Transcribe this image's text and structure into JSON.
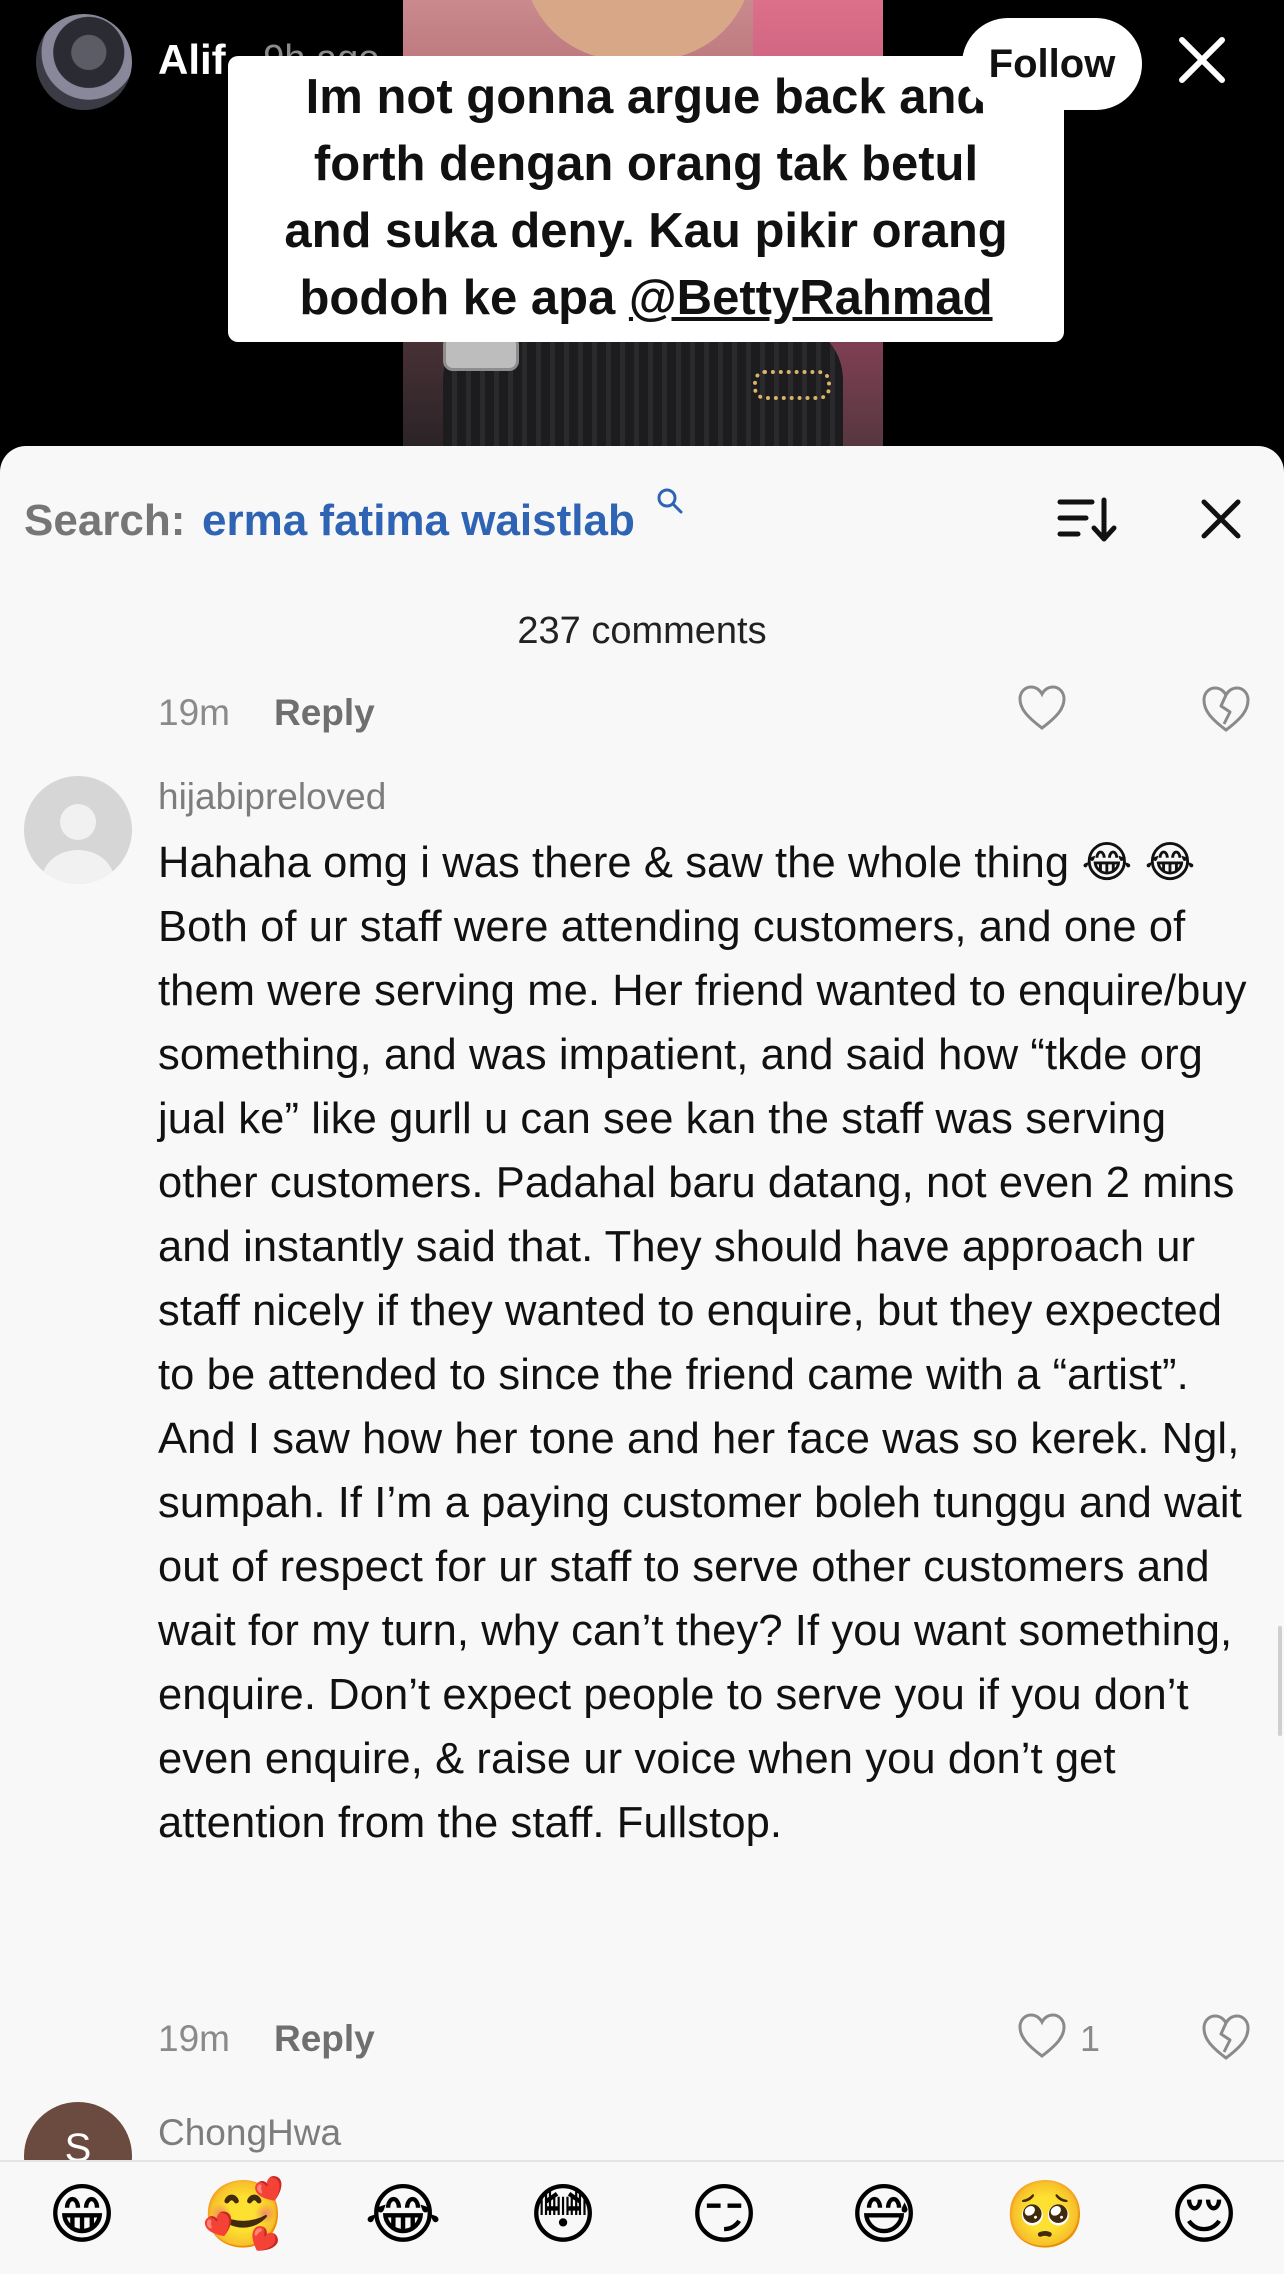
{
  "video": {
    "username": "Alif",
    "time_ago": "· 9h ago",
    "follow_label": "Follow",
    "caption_lines": [
      "Im not gonna argue back and",
      "forth dengan orang tak betul",
      "and suka deny. Kau pikir orang",
      "bodoh ke apa "
    ],
    "caption_mention": "@BettyRahmad"
  },
  "sheet": {
    "search_prefix": "Search:",
    "search_term": "erma fatima waistlab",
    "comment_count": "237 comments"
  },
  "previous_comment": {
    "time": "19m",
    "reply_label": "Reply"
  },
  "comment": {
    "username": "hijabipreloved",
    "text": "Hahaha omg i was there & saw the whole thing 😂 😂 Both of ur staff were attending customers, and one of them were serving me. Her friend wanted to enquire/buy something, and was impatient, and said how “tkde org jual ke” like gurll u can see kan the staff was serving other customers. Padahal baru datang, not even 2 mins and instantly said that. They should have approach ur staff nicely if they wanted to enquire, but they expected to be attended to since the friend came with a “artist”. And I saw how her tone and her face was so kerek. Ngl, sumpah. If I’m a paying customer boleh tunggu and wait out of respect for ur staff to serve other customers and wait for my turn, why can’t they? If you want something, enquire. Don’t expect people to serve you if you don’t even enquire, & raise ur voice when you don’t get attention from the staff. Fullstop.",
    "time": "19m",
    "reply_label": "Reply",
    "like_count": "1"
  },
  "next_comment": {
    "username": "ChongHwa",
    "avatar_letter": "S"
  },
  "emoji_bar": [
    "😁",
    "🥰",
    "😂",
    "😳",
    "😏",
    "😅",
    "🥺",
    "😌"
  ]
}
